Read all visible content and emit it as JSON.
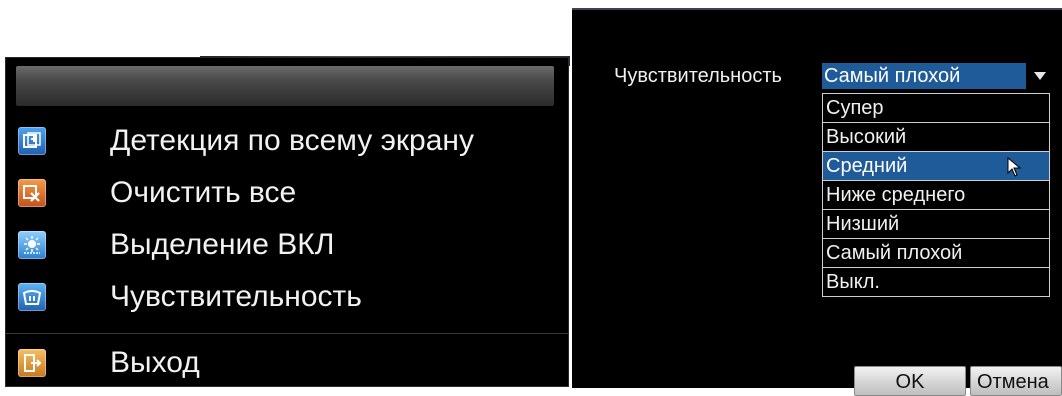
{
  "context_menu": {
    "items": [
      {
        "label": "Детекция по всему экрану",
        "icon": "fullscreen-detect-icon",
        "color": "#2f7fd0"
      },
      {
        "label": "Очистить все",
        "icon": "clear-all-icon",
        "color": "#e0701f"
      },
      {
        "label": "Выделение ВКЛ",
        "icon": "highlight-on-icon",
        "color": "#3aa0e6"
      },
      {
        "label": "Чувствительность",
        "icon": "sensitivity-icon",
        "color": "#2a76c2"
      },
      {
        "label": "Выход",
        "icon": "exit-icon",
        "color": "#d9952a"
      }
    ]
  },
  "dialog": {
    "sensitivity_label": "Чувствительность",
    "selected_value": "Самый плохой",
    "options": [
      "Супер",
      "Высокий",
      "Средний",
      "Ниже среднего",
      "Низший",
      "Самый плохой",
      "Выкл."
    ],
    "highlighted_option": "Средний",
    "ok_label": "OK",
    "cancel_label": "Отмена"
  },
  "colors": {
    "selection": "#1f5a99",
    "background": "#000000",
    "text": "#f0f0f0"
  }
}
